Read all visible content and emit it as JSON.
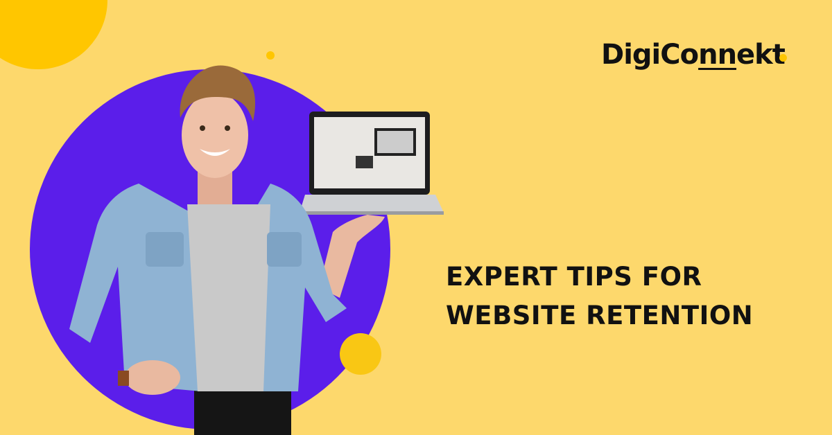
{
  "brand": {
    "name_pre": "DigiCo",
    "name_underlined": "nn",
    "name_post": "ekt",
    "full": "DigiConnekt"
  },
  "headline": {
    "line1": "EXPERT TIPS FOR",
    "line2": "WEBSITE RETENTION"
  },
  "colors": {
    "background": "#FDD86C",
    "accent_yellow": "#FFC600",
    "purple": "#5B1EEA",
    "text": "#111111"
  }
}
